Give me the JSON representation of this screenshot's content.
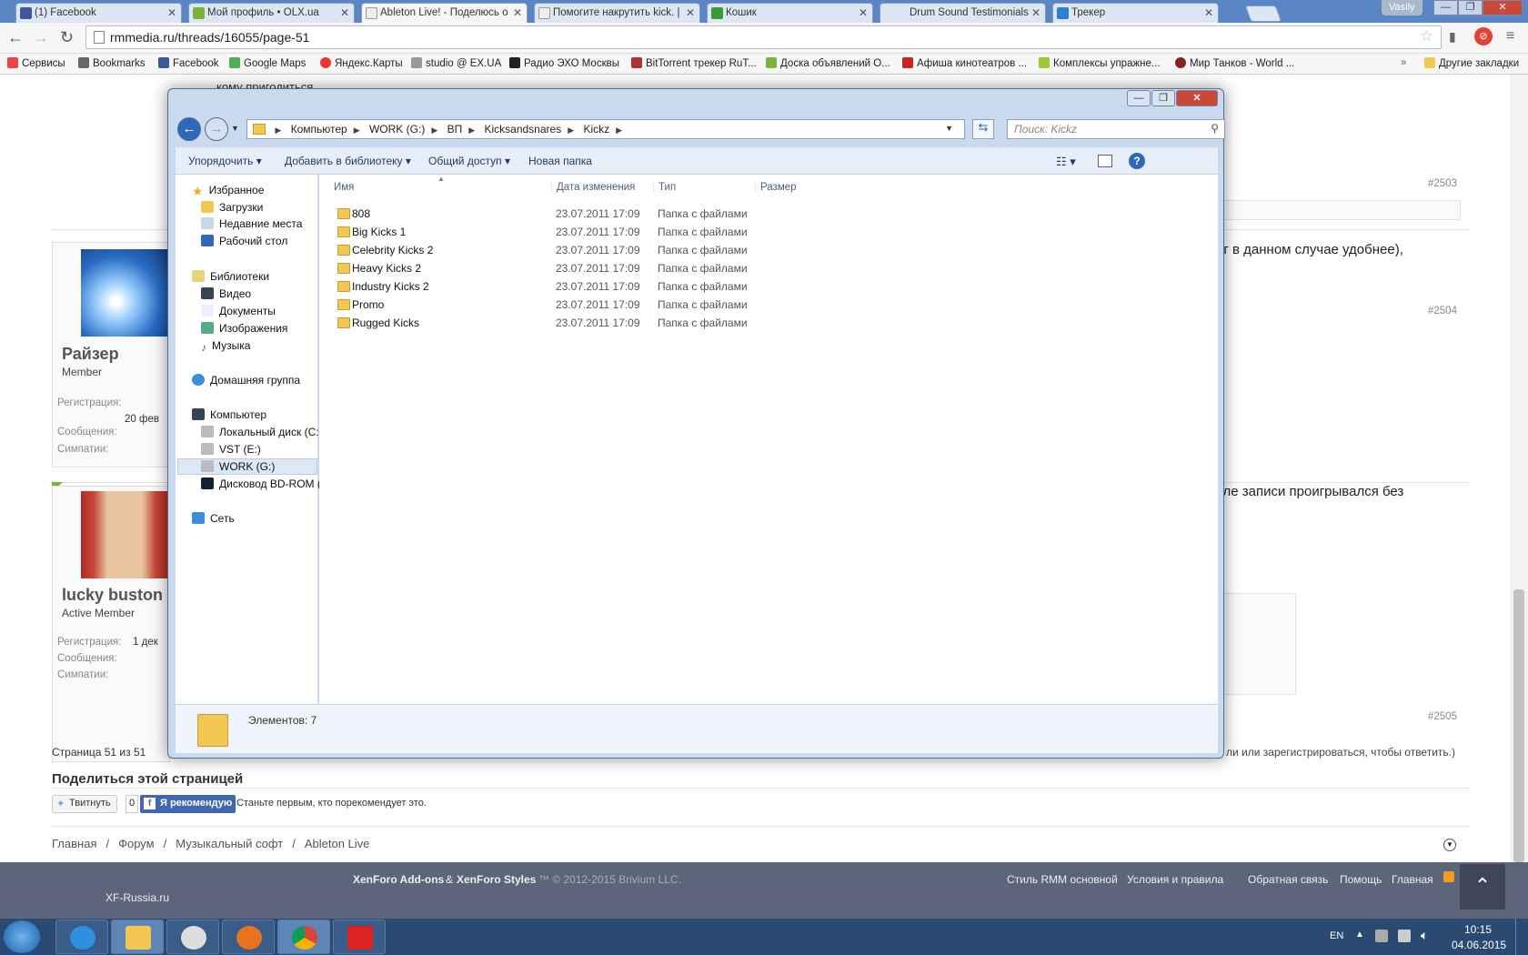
{
  "browser": {
    "tabs": [
      {
        "label": "(1) Facebook",
        "color": "#3b5998",
        "active": false
      },
      {
        "label": "Мой профиль • OLX.ua",
        "color": "#7fb23b",
        "active": false
      },
      {
        "label": "Ableton Live! - Поделюсь о",
        "color": "#eeeeee",
        "active": true
      },
      {
        "label": "Помогите накрутить kick. |",
        "color": "#eeeeee",
        "active": false
      },
      {
        "label": "Кошик",
        "color": "#3a9a3a",
        "active": false
      },
      {
        "label": "Drum Sound Testimonials",
        "color": "#dddddd",
        "active": false
      },
      {
        "label": "Трекер",
        "color": "#2f7fd0",
        "active": false
      }
    ],
    "user": "Vasily",
    "url": "rmmedia.ru/threads/16055/page-51",
    "bookmarks": [
      "Сервисы",
      "Bookmarks",
      "Facebook",
      "Google Maps",
      "Яндекс.Карты",
      "studio @ EX.UA",
      "Радио ЭХО Москвы",
      "BitTorrent трекер RuT...",
      "Доска объявлений О...",
      "Афиша кинотеатров ...",
      "Комплексы упражне...",
      "Мир Танков - World ..."
    ],
    "other_bookmarks": "Другие закладки"
  },
  "forum": {
    "top_text": "кому пригодиться",
    "posts": [
      {
        "num": "#2503"
      },
      {
        "username": "Райзер",
        "role": "Member",
        "reg_label": "Регистрация:",
        "reg_value": "20 фев",
        "msgs_label": "Сообщения:",
        "likes_label": "Симпатии:",
        "text": "иг в данном случае удобнее),",
        "num": "#2504"
      },
      {
        "username": "lucky buston",
        "role": "Active Member",
        "reg_label": "Регистрация:",
        "reg_value": "1 дек",
        "msgs_label": "Сообщения:",
        "likes_label": "Симпатии:",
        "text": "сле записи проигрывался без",
        "num": "#2505"
      }
    ],
    "pagination": "Страница 51 из 51",
    "reply_hint": "ли или зарегистрироваться, чтобы ответить.)",
    "share_title": "Поделиться этой страницей",
    "tweet": "Твитнуть",
    "fb_count": "0",
    "fb_like": "Я рекомендую",
    "fb_text": "Станьте первым, кто порекомендует это.",
    "breadcrumbs": [
      "Главная",
      "Форум",
      "Музыкальный софт",
      "Ableton Live"
    ],
    "footer_left": "XenForo Add-ons",
    "footer_amp": "&",
    "footer_styles": "XenForo Styles",
    "footer_copy": "™ © 2012-2015 Brivium LLC.",
    "footer_xf": "XF-Russia.ru",
    "footer_links": [
      "Стиль RMM основной",
      "Условия и правила",
      "Обратная связь",
      "Помощь",
      "Главная"
    ]
  },
  "explorer": {
    "path": [
      "Компьютер",
      "WORK (G:)",
      "BП",
      "Kicksandsnares",
      "Kickz"
    ],
    "search_placeholder": "Поиск: Kickz",
    "commands": {
      "organize": "Упорядочить ▾",
      "library": "Добавить в библиотеку ▾",
      "share": "Общий доступ ▾",
      "new_folder": "Новая папка"
    },
    "nav": {
      "favorites": "Избранное",
      "fav_items": [
        "Загрузки",
        "Недавние места",
        "Рабочий стол"
      ],
      "libraries": "Библиотеки",
      "lib_items": [
        "Видео",
        "Документы",
        "Изображения",
        "Музыка"
      ],
      "homegroup": "Домашняя группа",
      "computer": "Компьютер",
      "drives": [
        "Локальный диск (C:)",
        "VST (E:)",
        "WORK (G:)",
        "Дисковод BD-ROM ("
      ],
      "network": "Сеть"
    },
    "columns": {
      "name": "Имя",
      "date": "Дата изменения",
      "type": "Тип",
      "size": "Размер"
    },
    "files": [
      {
        "name": "808",
        "date": "23.07.2011 17:09",
        "type": "Папка с файлами"
      },
      {
        "name": "Big Kicks 1",
        "date": "23.07.2011 17:09",
        "type": "Папка с файлами"
      },
      {
        "name": "Celebrity Kicks 2",
        "date": "23.07.2011 17:09",
        "type": "Папка с файлами"
      },
      {
        "name": "Heavy Kicks 2",
        "date": "23.07.2011 17:09",
        "type": "Папка с файлами"
      },
      {
        "name": "Industry Kicks 2",
        "date": "23.07.2011 17:09",
        "type": "Папка с файлами"
      },
      {
        "name": "Promo",
        "date": "23.07.2011 17:09",
        "type": "Папка с файлами"
      },
      {
        "name": "Rugged Kicks",
        "date": "23.07.2011 17:09",
        "type": "Папка с файлами"
      }
    ],
    "item_count": "Элементов: 7"
  },
  "taskbar": {
    "lang": "EN",
    "time": "10:15",
    "date": "04.06.2015",
    "apps": [
      "start",
      "internet-explorer",
      "windows-explorer",
      "media-app",
      "firefox",
      "chrome",
      "ableton"
    ]
  }
}
